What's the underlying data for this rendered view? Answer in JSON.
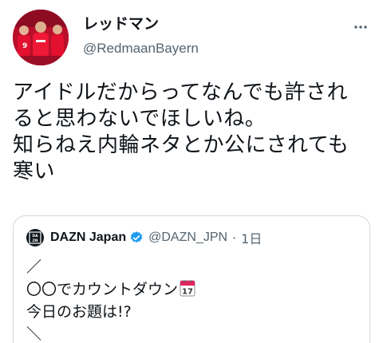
{
  "user": {
    "display_name": "レッドマン",
    "handle": "@RedmaanBayern",
    "avatar_icon": "team-photo-avatar",
    "brand_color": "#c8102e"
  },
  "tweet": {
    "lines": [
      "アイドルだからってなんでも許され",
      "ると思わないでほしいね。",
      "知らねえ内輪ネタとか公にされても",
      "寒い"
    ]
  },
  "quote": {
    "logo_text": "DAZN",
    "name": "DAZN Japan",
    "verified_icon": "verified-badge-icon",
    "handle": "@DAZN_JPN",
    "separator": "·",
    "time": "1日",
    "lines": [
      "／",
      "〇〇でカウントダウン",
      "今日のお題は!?",
      "＼"
    ],
    "calendar_icon": "calendar-icon",
    "calendar_day": "17",
    "verified_color": "#1d9bf0"
  },
  "more_icon": "more-options-icon"
}
